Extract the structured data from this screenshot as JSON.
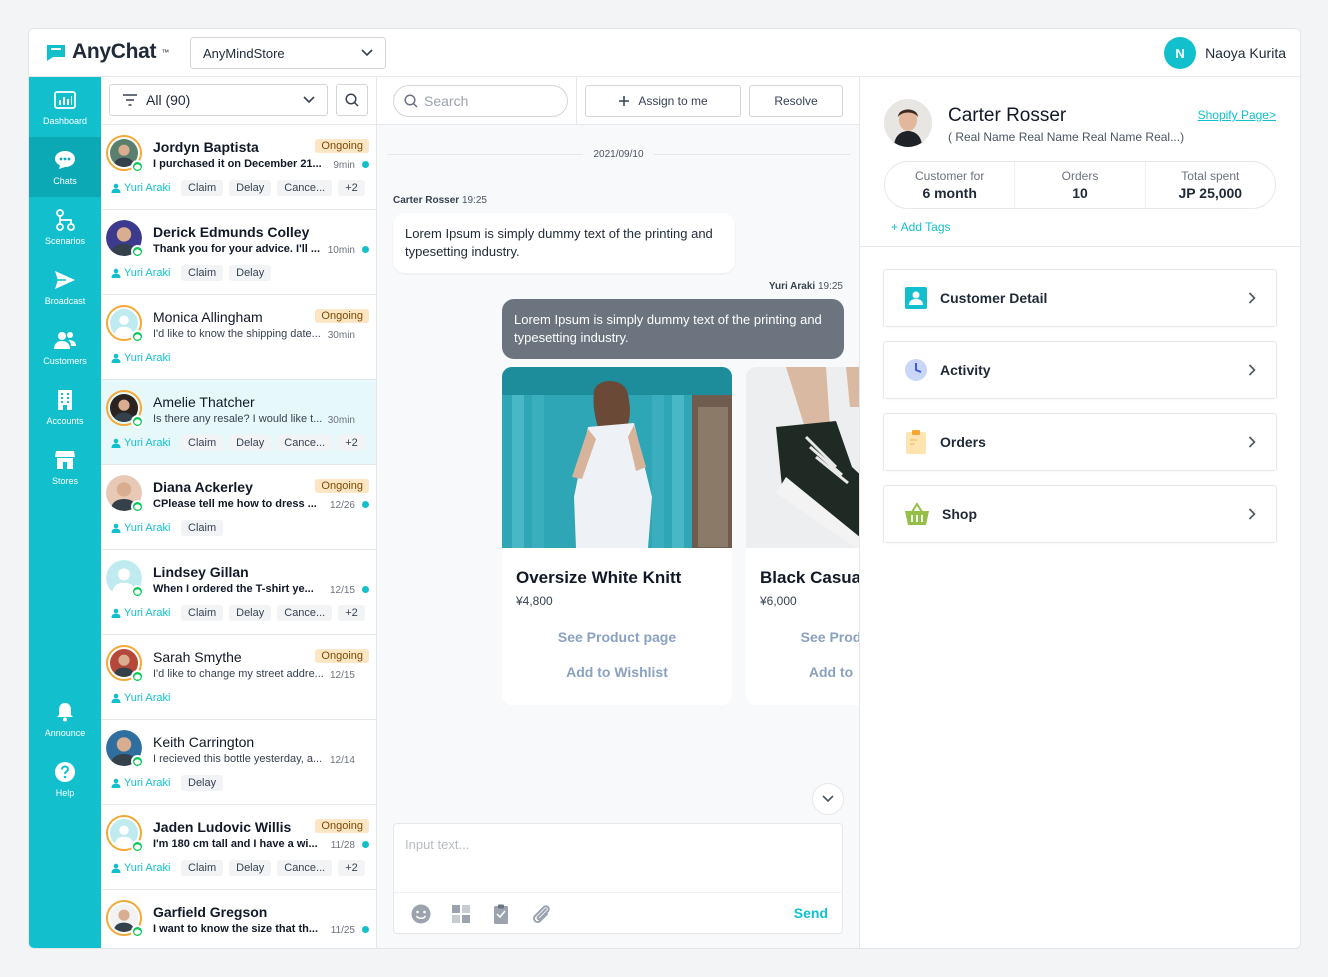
{
  "brand": {
    "name": "AnyChat",
    "tm": "™"
  },
  "store_select": {
    "value": "AnyMindStore"
  },
  "user": {
    "initial": "N",
    "name": "Naoya Kurita"
  },
  "sidebar": {
    "items": [
      {
        "label": "Dashboard",
        "icon": "bar-chart-icon"
      },
      {
        "label": "Chats",
        "icon": "chat-bubble-icon",
        "active": true
      },
      {
        "label": "Scenarios",
        "icon": "flow-icon"
      },
      {
        "label": "Broadcast",
        "icon": "send-icon"
      },
      {
        "label": "Customers",
        "icon": "people-icon"
      },
      {
        "label": "Accounts",
        "icon": "building-icon"
      },
      {
        "label": "Stores",
        "icon": "store-icon"
      }
    ],
    "bottom": [
      {
        "label": "Announce",
        "icon": "bell-icon"
      },
      {
        "label": "Help",
        "icon": "help-icon"
      }
    ]
  },
  "conv_list": {
    "filter_value": "All (90)",
    "items": [
      {
        "name": "Jordyn Baptista",
        "status": "Ongoing",
        "msg": "I purchased it on December 21...",
        "time": "9min",
        "unread": true,
        "agent": "Yuri Araki",
        "tags": [
          "Claim",
          "Delay",
          "Cance...",
          "+2"
        ]
      },
      {
        "name": "Derick Edmunds Colley",
        "status": "",
        "msg": "Thank you for your advice. I'll ...",
        "time": "10min",
        "unread": true,
        "agent": "Yuri Araki",
        "tags": [
          "Claim",
          "Delay"
        ]
      },
      {
        "name": "Monica Allingham",
        "status": "Ongoing",
        "msg": "I'd like to know the shipping date...",
        "time": "30min",
        "unread": false,
        "agent": "Yuri Araki",
        "tags": []
      },
      {
        "name": "Amelie Thatcher",
        "status": "",
        "msg": "Is there any resale? I would like t...",
        "time": "30min",
        "unread": false,
        "agent": "Yuri Araki",
        "tags": [
          "Claim",
          "Delay",
          "Cance...",
          "+2"
        ]
      },
      {
        "name": "Diana Ackerley",
        "status": "Ongoing",
        "msg": "CPlease tell me how to dress ...",
        "time": "12/26",
        "unread": true,
        "agent": "Yuri Araki",
        "tags": [
          "Claim"
        ]
      },
      {
        "name": "Lindsey Gillan",
        "status": "",
        "msg": "When I ordered the T-shirt ye...",
        "time": "12/15",
        "unread": true,
        "agent": "Yuri Araki",
        "tags": [
          "Claim",
          "Delay",
          "Cance...",
          "+2"
        ]
      },
      {
        "name": "Sarah Smythe",
        "status": "Ongoing",
        "msg": "I'd like to change my street addre...",
        "time": "12/15",
        "unread": false,
        "agent": "Yuri Araki",
        "tags": []
      },
      {
        "name": "Keith Carrington",
        "status": "",
        "msg": "I recieved this bottle yesterday, a...",
        "time": "12/14",
        "unread": false,
        "agent": "Yuri Araki",
        "tags": [
          "Delay"
        ]
      },
      {
        "name": "Jaden Ludovic Willis",
        "status": "Ongoing",
        "msg": "I'm 180 cm tall and I have a wi...",
        "time": "11/28",
        "unread": true,
        "agent": "Yuri Araki",
        "tags": [
          "Claim",
          "Delay",
          "Cance...",
          "+2"
        ]
      },
      {
        "name": "Garfield Gregson",
        "status": "",
        "msg": "I want to know the size that th...",
        "time": "11/25",
        "unread": true,
        "agent": "Yuri Araki",
        "tags": []
      }
    ]
  },
  "chat": {
    "search_placeholder": "Search",
    "assign_label": "Assign to me",
    "resolve_label": "Resolve",
    "date": "2021/09/10",
    "in_sender": "Carter Rosser",
    "in_time": "19:25",
    "in_text": "Lorem Ipsum is simply dummy text of the printing and typesetting industry.",
    "out_sender": "Yuri Araki",
    "out_time": "19:25",
    "out_text": "Lorem Ipsum is simply dummy text of the printing and typesetting industry.",
    "products": [
      {
        "name": "Oversize White Knitt",
        "price": "¥4,800",
        "link1": "See Product page",
        "link2": "Add to Wishlist"
      },
      {
        "name": "Black Casua",
        "price": "¥6,000",
        "link1": "See Prod",
        "link2": "Add to"
      }
    ],
    "input_placeholder": "Input text...",
    "send_label": "Send"
  },
  "customer": {
    "name": "Carter Rosser",
    "real_name": "( Real Name Real Name Real Name Real...)",
    "shop_link": "Shopify Page>",
    "stats": [
      {
        "label": "Customer for",
        "value": "6 month"
      },
      {
        "label": "Orders",
        "value": "10"
      },
      {
        "label": "Total spent",
        "value": "JP 25,000"
      }
    ],
    "add_tags": "+ Add Tags",
    "cards": [
      {
        "label": "Customer Detail",
        "icon": "customer-detail-icon"
      },
      {
        "label": "Activity",
        "icon": "clock-icon"
      },
      {
        "label": "Orders",
        "icon": "clipboard-icon"
      },
      {
        "label": "Shop",
        "icon": "basket-icon"
      }
    ]
  },
  "colors": {
    "accent": "#12c0cd",
    "ongoing_bg": "#fde6c4",
    "line_green": "#06c755",
    "bubble_out": "#6c7480"
  }
}
